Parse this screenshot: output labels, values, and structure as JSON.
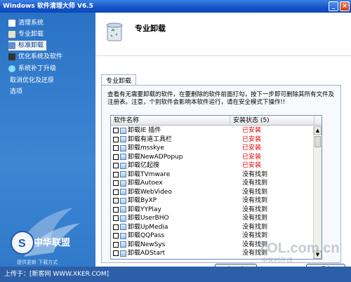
{
  "window": {
    "title": "Windows 软件清理大师 V6.5"
  },
  "sidebar": {
    "items": [
      {
        "label": "清理系统",
        "icon": "clean-icon"
      },
      {
        "label": "专业卸载",
        "icon": "uninstall-icon"
      },
      {
        "label": "标准卸载",
        "icon": "standard-uninstall-icon"
      },
      {
        "label": "优化系统及软件",
        "icon": "optimize-icon"
      },
      {
        "label": "系统补丁升级",
        "icon": "patch-icon"
      },
      {
        "label": "取消优化及还原"
      },
      {
        "label": "选项"
      }
    ],
    "active_index": 2,
    "logo_text": "中华联盟",
    "logo_sub": "提供更新 下载方式"
  },
  "footer": {
    "text": "上传于：[新客网 WWW.XKER.COM]"
  },
  "main": {
    "title": "专业卸载",
    "tab": "专业卸载",
    "description": "查看有无需要卸载的软件，在要删除的软件前面打勾，按下一步即可删除其所有文件及注册表。注意，个别软件会影响本软件运行，请在安全模式下操作!!",
    "columns": {
      "name": "软件名称",
      "status": "安装状态 (5)"
    },
    "rows": [
      {
        "name": "卸载IE 插件",
        "status": "已安装",
        "installed": true
      },
      {
        "name": "卸载有道工具栏",
        "status": "已安装",
        "installed": true
      },
      {
        "name": "卸载msskye",
        "status": "已安装",
        "installed": true
      },
      {
        "name": "卸载NewADPopup",
        "status": "已安装",
        "installed": true
      },
      {
        "name": "卸载亿起搜",
        "status": "已安装",
        "installed": true
      },
      {
        "name": "卸载TVmware",
        "status": "没有找到",
        "installed": false
      },
      {
        "name": "卸载Autoex",
        "status": "没有找到",
        "installed": false
      },
      {
        "name": "卸载WebVideo",
        "status": "没有找到",
        "installed": false
      },
      {
        "name": "卸载ByXP",
        "status": "没有找到",
        "installed": false
      },
      {
        "name": "卸载YYPlay",
        "status": "没有找到",
        "installed": false
      },
      {
        "name": "卸载UserBHO",
        "status": "没有找到",
        "installed": false
      },
      {
        "name": "卸载UpMedia",
        "status": "没有找到",
        "installed": false
      },
      {
        "name": "卸载QQPass",
        "status": "没有找到",
        "installed": false
      },
      {
        "name": "卸载NewSys",
        "status": "没有找到",
        "installed": false
      },
      {
        "name": "卸载ADStart",
        "status": "没有找到",
        "installed": false
      }
    ],
    "buttons": {
      "prev": "上一步",
      "exit": "退出"
    }
  },
  "watermark": {
    "site": "ZOL.com.cn",
    "sub": "中关村在线"
  },
  "colors": {
    "sidebar": "#3d86d4",
    "installed": "#e00000",
    "title_bar": "#1454c8"
  }
}
